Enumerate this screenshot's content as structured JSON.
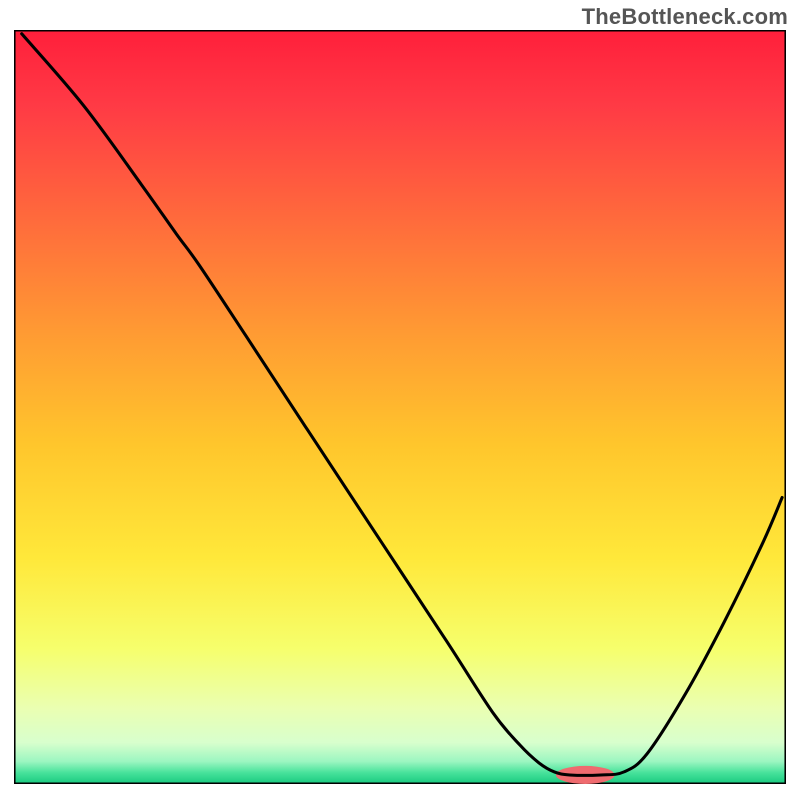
{
  "watermark": "TheBottleneck.com",
  "chart_data": {
    "type": "line",
    "title": "",
    "xlabel": "",
    "ylabel": "",
    "x_range": [
      0,
      1
    ],
    "y_range": [
      0,
      1
    ],
    "grid": false,
    "legend": false,
    "gradient_stops": [
      {
        "offset": 0.0,
        "color": "#ff1f3b"
      },
      {
        "offset": 0.1,
        "color": "#ff3a45"
      },
      {
        "offset": 0.25,
        "color": "#ff6a3c"
      },
      {
        "offset": 0.4,
        "color": "#ff9a33"
      },
      {
        "offset": 0.55,
        "color": "#ffc62c"
      },
      {
        "offset": 0.7,
        "color": "#ffe83a"
      },
      {
        "offset": 0.82,
        "color": "#f6ff6c"
      },
      {
        "offset": 0.9,
        "color": "#eaffb2"
      },
      {
        "offset": 0.945,
        "color": "#d8ffcd"
      },
      {
        "offset": 0.97,
        "color": "#9cf6c1"
      },
      {
        "offset": 0.985,
        "color": "#47e29b"
      },
      {
        "offset": 1.0,
        "color": "#18c97f"
      }
    ],
    "series": [
      {
        "name": "bottleneck-curve",
        "color": "#000000",
        "points": [
          {
            "x": 0.01,
            "y": 0.995
          },
          {
            "x": 0.09,
            "y": 0.9
          },
          {
            "x": 0.165,
            "y": 0.795
          },
          {
            "x": 0.21,
            "y": 0.73
          },
          {
            "x": 0.24,
            "y": 0.688
          },
          {
            "x": 0.3,
            "y": 0.595
          },
          {
            "x": 0.38,
            "y": 0.47
          },
          {
            "x": 0.47,
            "y": 0.33
          },
          {
            "x": 0.56,
            "y": 0.19
          },
          {
            "x": 0.62,
            "y": 0.095
          },
          {
            "x": 0.655,
            "y": 0.052
          },
          {
            "x": 0.68,
            "y": 0.028
          },
          {
            "x": 0.7,
            "y": 0.016
          },
          {
            "x": 0.72,
            "y": 0.012
          },
          {
            "x": 0.76,
            "y": 0.012
          },
          {
            "x": 0.79,
            "y": 0.016
          },
          {
            "x": 0.82,
            "y": 0.04
          },
          {
            "x": 0.87,
            "y": 0.12
          },
          {
            "x": 0.92,
            "y": 0.215
          },
          {
            "x": 0.97,
            "y": 0.32
          },
          {
            "x": 0.995,
            "y": 0.38
          }
        ]
      }
    ],
    "marker": {
      "name": "optimal-zone",
      "color": "#ef6b6f",
      "cx": 0.74,
      "cy": 0.012,
      "rx": 0.038,
      "ry": 0.012
    }
  }
}
